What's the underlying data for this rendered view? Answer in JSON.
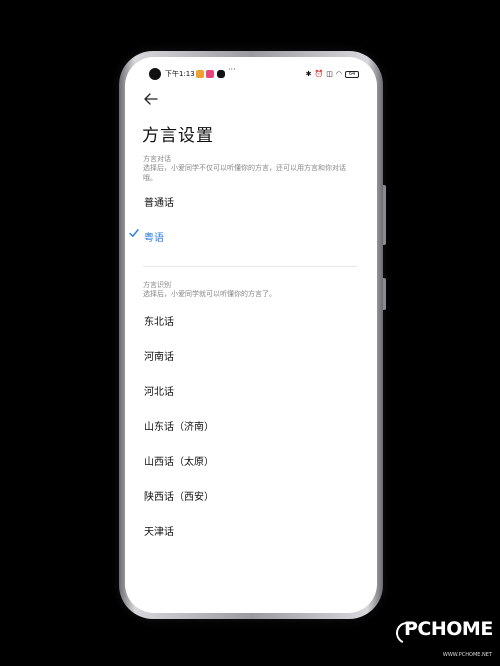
{
  "status_bar": {
    "time": "下午1:13",
    "dots": "···",
    "battery_level": "64"
  },
  "header": {
    "title": "方言设置"
  },
  "dialect_chat": {
    "section_title": "方言对话",
    "description": "选择后，小爱同学不仅可以听懂你的方言，还可以用方言和你对话哦。",
    "options": [
      {
        "label": "普通话",
        "selected": false
      },
      {
        "label": "粤语",
        "selected": true
      }
    ]
  },
  "dialect_recognition": {
    "section_title": "方言识别",
    "description": "选择后，小爱同学就可以听懂你的方言了。",
    "options": [
      {
        "label": "东北话"
      },
      {
        "label": "河南话"
      },
      {
        "label": "河北话"
      },
      {
        "label": "山东话（济南）"
      },
      {
        "label": "山西话（太原）"
      },
      {
        "label": "陕西话（西安）"
      },
      {
        "label": "天津话"
      }
    ]
  },
  "watermark": {
    "brand": "PCHOME",
    "url": "WWW.PCHOME.NET"
  },
  "colors": {
    "accent": "#2c7de0",
    "background": "#000000",
    "screen": "#ffffff"
  }
}
